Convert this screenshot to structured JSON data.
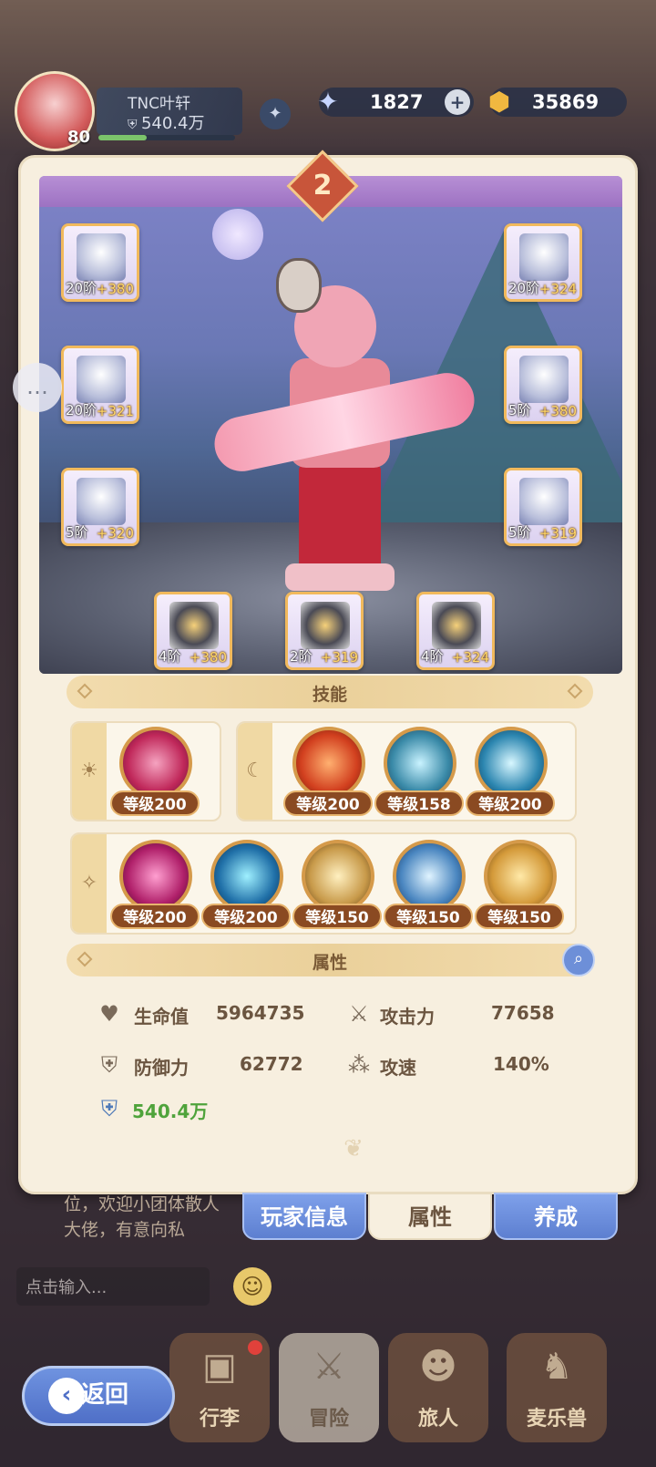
{
  "player": {
    "name": "TNC叶轩",
    "power": "540.4万",
    "level": "80"
  },
  "resources": {
    "stars": "1827",
    "gold": "35869"
  },
  "panel": {
    "badge_level": "2",
    "equipment": [
      {
        "tier": "20阶",
        "plus": "+380"
      },
      {
        "tier": "20阶",
        "plus": "+324"
      },
      {
        "tier": "20阶",
        "plus": "+321"
      },
      {
        "tier": "5阶",
        "plus": "+380"
      },
      {
        "tier": "5阶",
        "plus": "+320"
      },
      {
        "tier": "5阶",
        "plus": "+319"
      },
      {
        "tier": "4阶",
        "plus": "+380"
      },
      {
        "tier": "2阶",
        "plus": "+319"
      },
      {
        "tier": "4阶",
        "plus": "+324"
      }
    ],
    "skills_title": "技能",
    "skill_groups": {
      "sun": {
        "icon": "☀",
        "skills": [
          {
            "level": "等级200"
          }
        ]
      },
      "moon": {
        "icon": "☾",
        "skills": [
          {
            "level": "等级200"
          },
          {
            "level": "等级158"
          },
          {
            "level": "等级200"
          }
        ]
      },
      "star": {
        "icon": "✧",
        "skills": [
          {
            "level": "等级200"
          },
          {
            "level": "等级200"
          },
          {
            "level": "等级150"
          },
          {
            "level": "等级150"
          },
          {
            "level": "等级150"
          }
        ]
      }
    },
    "attributes_title": "属性",
    "attributes": {
      "hp_label": "生命值",
      "hp_value": "5964735",
      "atk_label": "攻击力",
      "atk_value": "77658",
      "def_label": "防御力",
      "def_value": "62772",
      "speed_label": "攻速",
      "speed_value": "140%",
      "power_value": "540.4万"
    }
  },
  "tabs": {
    "player_info": "玩家信息",
    "attributes": "属性",
    "training": "养成"
  },
  "chat": {
    "line1": "位，欢迎小团体散人",
    "line2": "大佬，有意向私",
    "input_placeholder": "点击输入..."
  },
  "nav": {
    "luggage": "行李",
    "adventure": "冒险",
    "traveler": "旅人",
    "beast": "麦乐兽"
  },
  "back_label": "返回",
  "colors": {
    "accent_blue": "#5d7fd0",
    "panel_bg": "#f7efdf",
    "gold": "#f1b95c",
    "skill_level_bg": "#8a4a22"
  }
}
